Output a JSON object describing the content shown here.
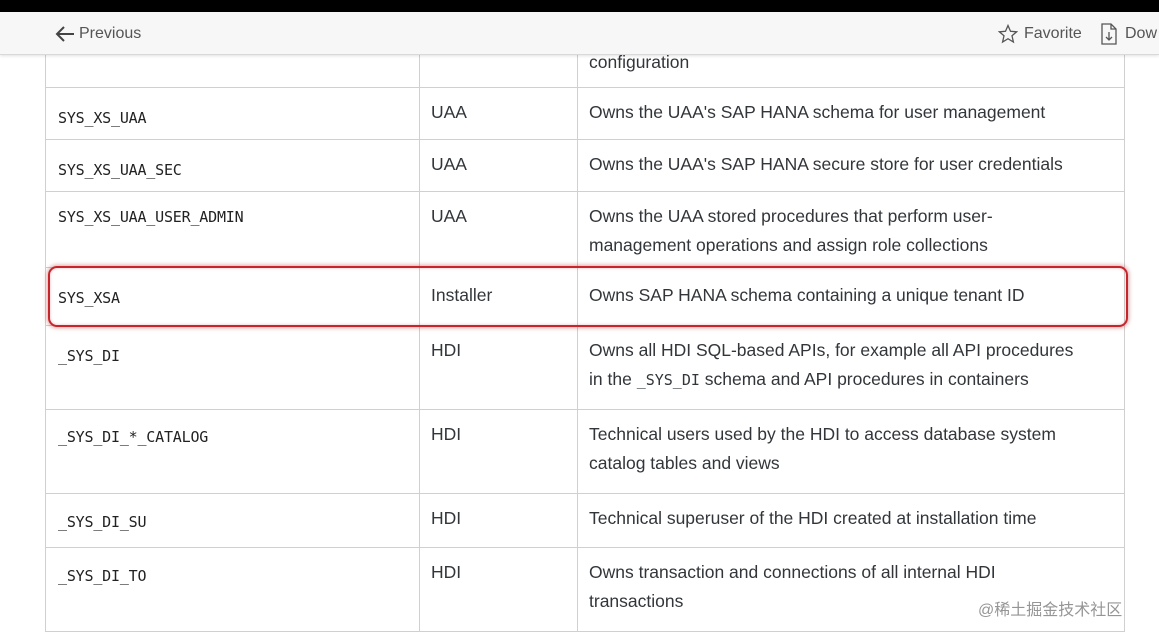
{
  "toolbar": {
    "previous_label": "Previous",
    "favorite_label": "Favorite",
    "download_label": "Dow"
  },
  "table": {
    "rows": [
      {
        "user": "",
        "component": "",
        "description": "configuration"
      },
      {
        "user": "SYS_XS_UAA",
        "component": "UAA",
        "description": "Owns the UAA's SAP HANA schema for user management"
      },
      {
        "user": "SYS_XS_UAA_SEC",
        "component": "UAA",
        "description": "Owns the UAA's SAP HANA secure store for user credentials"
      },
      {
        "user": "SYS_XS_UAA_USER_ADMIN",
        "component": "UAA",
        "description_line1": "Owns the UAA stored procedures that perform user-",
        "description_line2": "management operations and assign role collections"
      },
      {
        "user": "SYS_XSA",
        "component": "Installer",
        "description": "Owns SAP HANA schema containing a unique tenant ID"
      },
      {
        "user": "_SYS_DI",
        "component": "HDI",
        "description_line1": "Owns all HDI SQL-based APIs, for example all API procedures",
        "description_line2_pre": "in the ",
        "description_line2_code": "_SYS_DI",
        "description_line2_post": " schema and API procedures in containers"
      },
      {
        "user": "_SYS_DI_*_CATALOG",
        "component": "HDI",
        "description_line1": "Technical users used by the HDI to access database system",
        "description_line2": "catalog tables and views"
      },
      {
        "user": "_SYS_DI_SU",
        "component": "HDI",
        "description": "Technical superuser of the HDI created at installation time"
      },
      {
        "user": "_SYS_DI_TO",
        "component": "HDI",
        "description_line1": "Owns transaction and connections of all internal HDI",
        "description_line2": "transactions"
      }
    ]
  },
  "watermark": "@稀土掘金技术社区",
  "colors": {
    "highlight_border": "#c9242a",
    "toolbar_bg": "#f7f7f7",
    "border": "#d0d0d0"
  }
}
